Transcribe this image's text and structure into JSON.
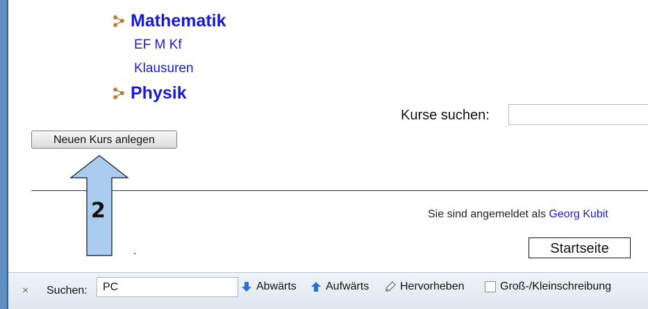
{
  "categories": [
    {
      "name": "Mathematik",
      "subs": [
        "EF M Kf",
        "Klausuren"
      ]
    },
    {
      "name": "Physik",
      "subs": []
    }
  ],
  "search": {
    "label": "Kurse suchen:",
    "value": ""
  },
  "new_course_button": "Neuen Kurs anlegen",
  "login": {
    "prefix": "Sie sind angemeldet als ",
    "user": "Georg Kubit"
  },
  "start_button": "Startseite",
  "annotation_number": "2",
  "findbar": {
    "close": "×",
    "label": "Suchen:",
    "value": "PC",
    "down": "Abwärts",
    "up": "Aufwärts",
    "highlight": "Hervorheben",
    "case": "Groß-/Kleinschreibung"
  },
  "colors": {
    "link": "#1a1acd",
    "arrow_fill": "#a9ccf0",
    "frame": "#5f8fc2"
  }
}
